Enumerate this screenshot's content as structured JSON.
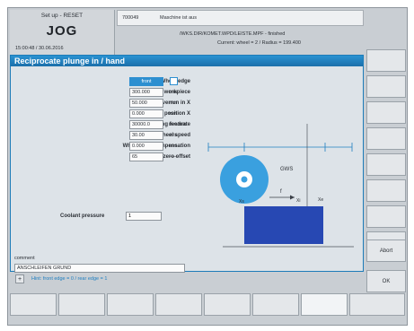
{
  "header": {
    "setup": "Set up - RESET",
    "mode": "JOG",
    "datetime": "15:00:48 / 30.06.2016",
    "alarm_number": "700049",
    "alarm_message": "Maschine ist aus",
    "program_path": "/WKS.DIR/KOMET.WPD/LEISTE.MPF - finished",
    "current_info": "Current:  wheel = 2  /  Radius = 199.400"
  },
  "dialog": {
    "title": "Reciprocate plunge in  / hand",
    "fields": [
      {
        "label": "Wheel edge",
        "value": "front",
        "unit": ""
      },
      {
        "label": "Length of workpiece",
        "value": "300.000",
        "unit": "mm"
      },
      {
        "label": "Length of overrun in X",
        "value": "50.000",
        "unit": "mm"
      },
      {
        "label": "Starting position X",
        "value": "0.000",
        "unit": "mm"
      },
      {
        "label": "Grinding feedrate",
        "value": "30000.0",
        "unit": "mm/min"
      },
      {
        "label": "wheel speed",
        "value": "30.00",
        "unit": "m/s"
      },
      {
        "label": "Wheel wear compensation",
        "value": "0.000",
        "unit": "mm"
      },
      {
        "label": "Number of zero offset",
        "value": "65",
        "unit": "——"
      }
    ],
    "coolant_label": "Coolant pressure",
    "coolant_value": "1",
    "comment_label": "comment",
    "comment_value": "ANSCHLEIFEN GRUND",
    "diagram": {
      "gws": "GWS",
      "f": "f",
      "xs": "Xs",
      "xi": "Xi",
      "xe": "Xe"
    }
  },
  "softkeys_vertical": [
    "",
    "",
    "",
    "",
    "",
    "",
    "",
    "",
    "Abort",
    "OK"
  ],
  "status": {
    "plus": "+",
    "hint": "Hint:  front edge = 0 / rear edge = 1"
  },
  "softkeys_horizontal": [
    "",
    "",
    "",
    "",
    "",
    "",
    "",
    ""
  ],
  "colors": {
    "accent": "#1f7fc0",
    "wheel": "#3aa0df",
    "workpiece": "#2748b3"
  }
}
